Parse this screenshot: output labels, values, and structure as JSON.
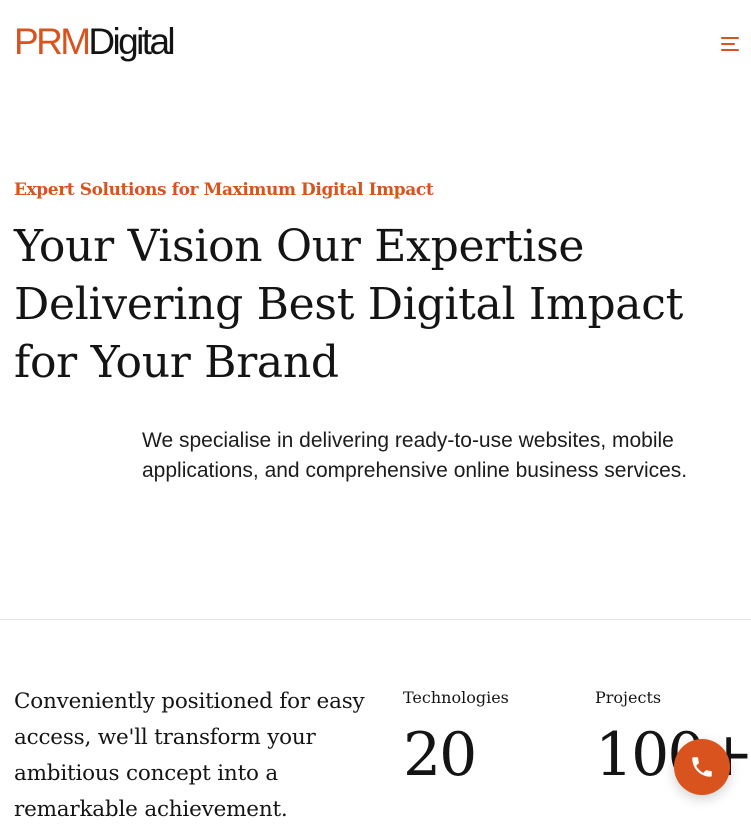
{
  "header": {
    "logo_brand": "PRM",
    "logo_suffix": "Digital",
    "menu_icon": "hamburger-menu-icon"
  },
  "hero": {
    "eyebrow": "Expert Solutions for Maximum Digital Impact",
    "title": "Your Vision Our Expertise Delivering Best Digital Impact for Your Brand",
    "description": "We specialise in delivering ready-to-use websites, mobile applications, and comprehensive online business services."
  },
  "about": {
    "text": "Conveniently positioned for easy access, we'll transform your ambitious concept into a remarkable achievement."
  },
  "stats": [
    {
      "label": "Technologies",
      "value": "20"
    },
    {
      "label": "Projects",
      "value": "100+"
    }
  ],
  "call_button": {
    "icon": "phone-icon"
  },
  "colors": {
    "accent": "#D9531E",
    "text": "#141414",
    "divider": "#E4E4E4",
    "background": "#FFFFFF"
  }
}
